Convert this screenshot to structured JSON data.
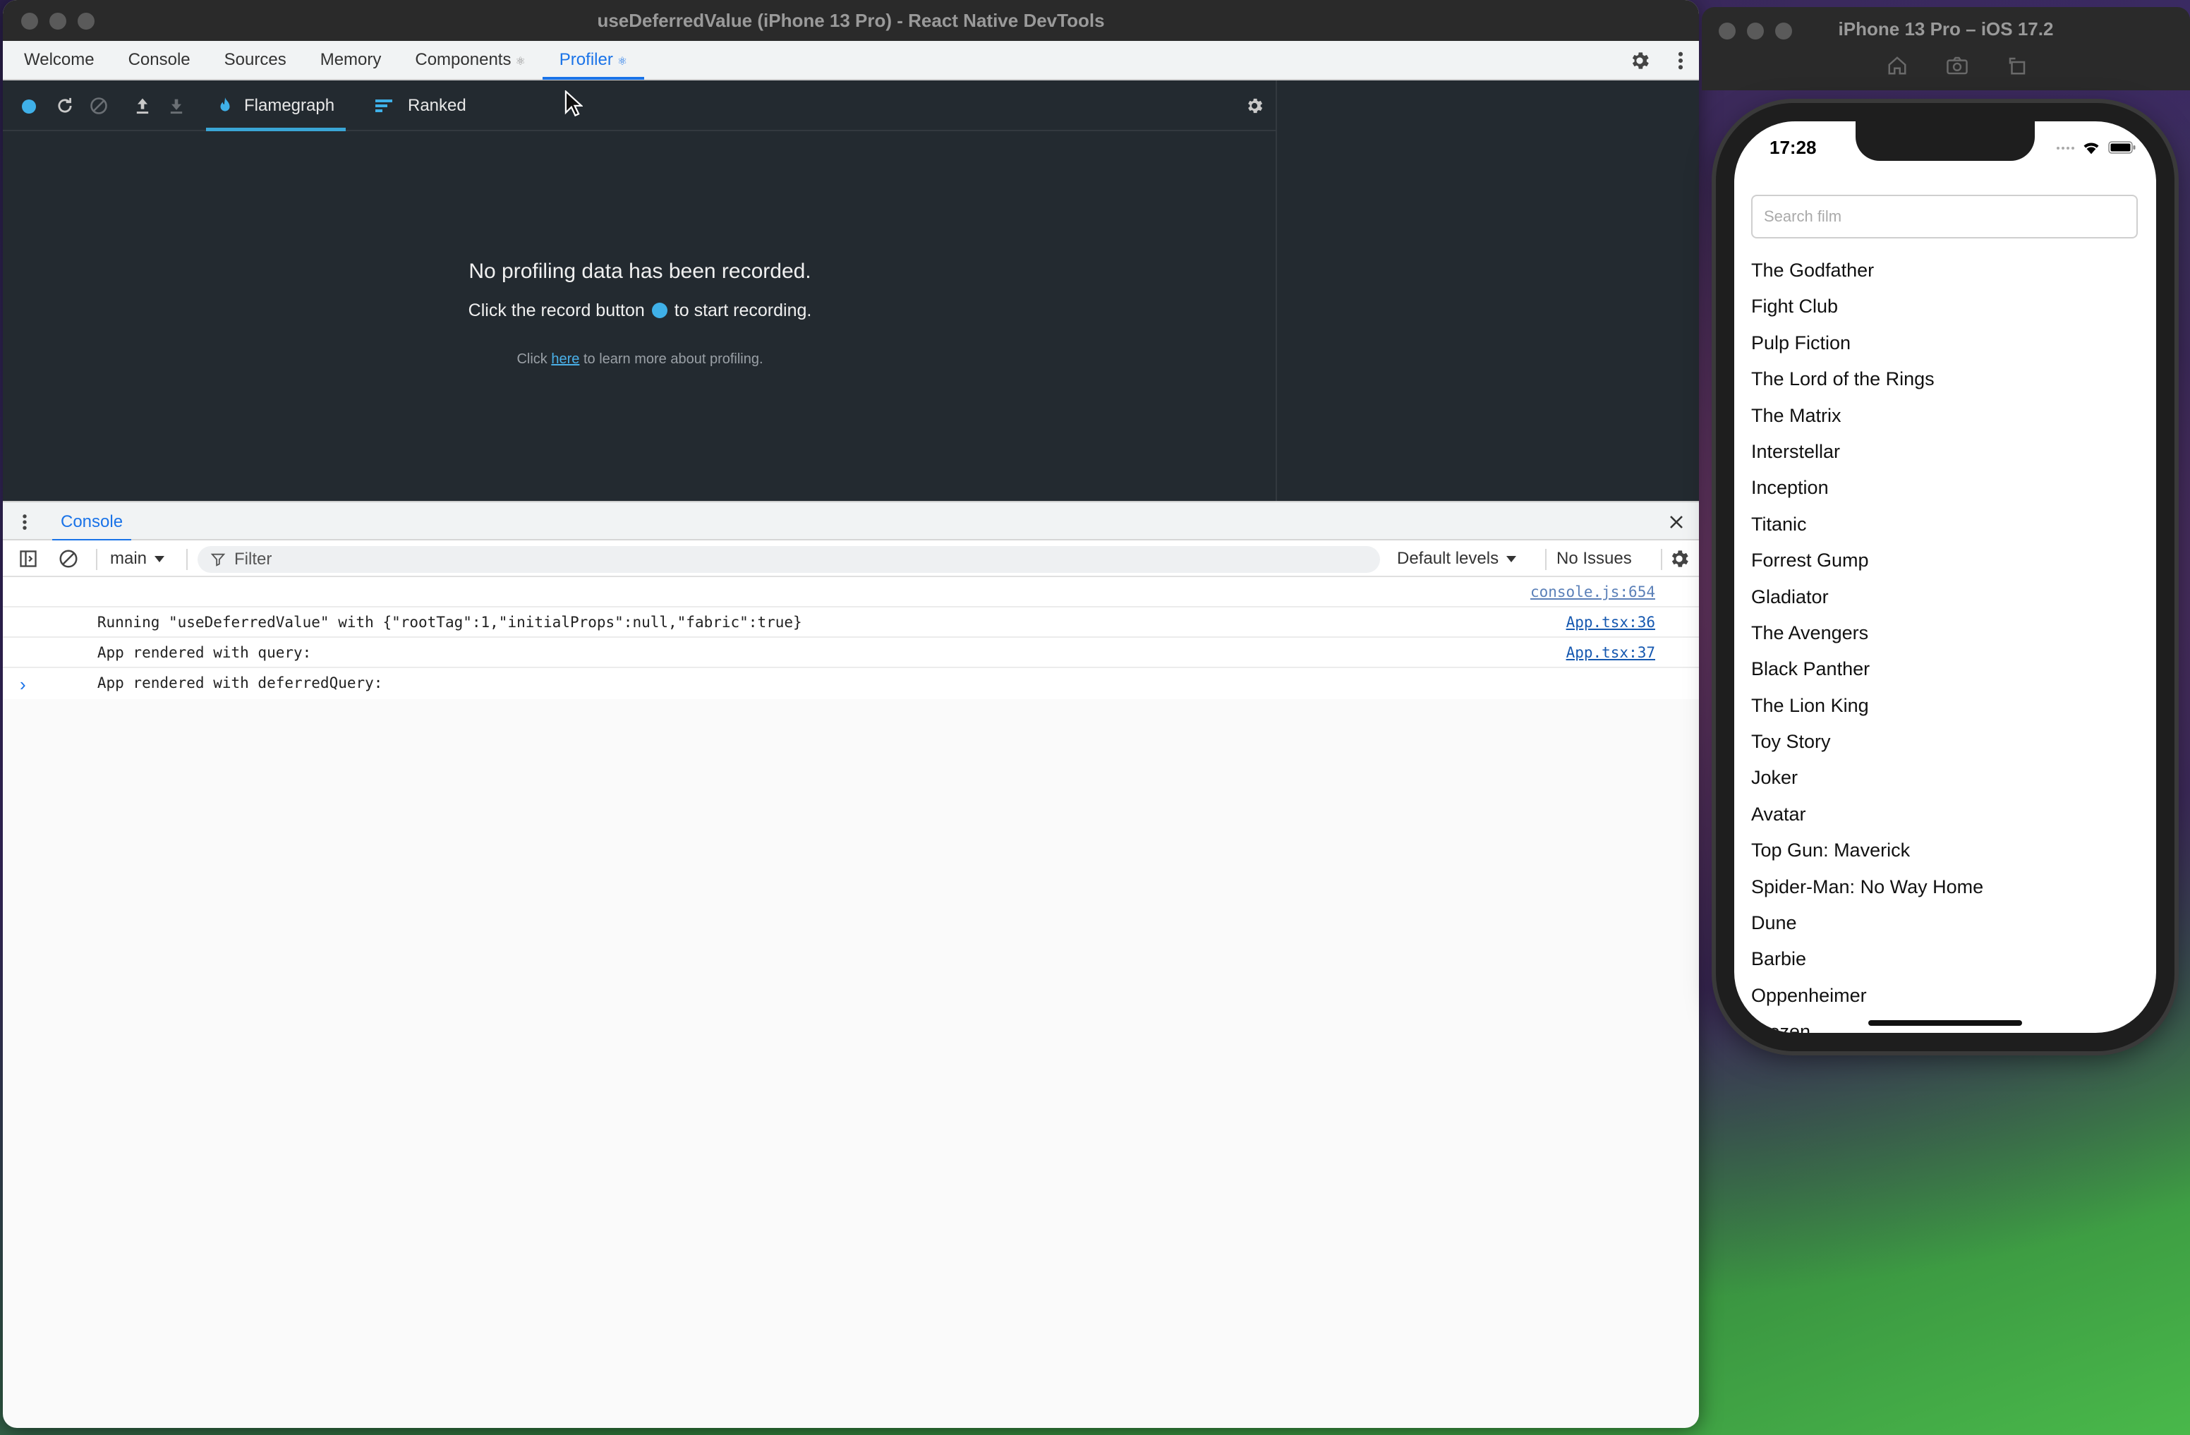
{
  "devtools": {
    "window_title": "useDeferredValue (iPhone 13 Pro) - React Native DevTools",
    "tabs": [
      {
        "label": "Welcome"
      },
      {
        "label": "Console"
      },
      {
        "label": "Sources"
      },
      {
        "label": "Memory"
      },
      {
        "label": "Components",
        "react_mark": "⚛"
      },
      {
        "label": "Profiler",
        "react_mark": "⚛",
        "active": true
      }
    ],
    "profiler": {
      "tabs": {
        "flamegraph": "Flamegraph",
        "ranked": "Ranked"
      },
      "empty_title": "No profiling data has been recorded.",
      "empty_hint_before": "Click the record button",
      "empty_hint_after": "to start recording.",
      "learn_before": "Click",
      "learn_link": "here",
      "learn_after": "to learn more about profiling.",
      "accent_color": "#3fb0e8"
    },
    "drawer": {
      "tab_label": "Console",
      "context": "main",
      "filter_placeholder": "Filter",
      "levels": "Default levels",
      "issues": "No Issues",
      "messages": [
        {
          "text": "Running \"useDeferredValue\" with {\"rootTag\":1,\"initialProps\":null,\"fabric\":true}",
          "source": "console.js:654"
        },
        {
          "text": "App rendered with query:",
          "source": "App.tsx:36"
        },
        {
          "text": "App rendered with deferredQuery:",
          "source": "App.tsx:37"
        }
      ],
      "prompt": "›"
    }
  },
  "simulator": {
    "window_title": "iPhone 13 Pro – iOS 17.2",
    "status_time": "17:28",
    "search_placeholder": "Search film",
    "films": [
      "The Godfather",
      "Fight Club",
      "Pulp Fiction",
      "The Lord of the Rings",
      "The Matrix",
      "Interstellar",
      "Inception",
      "Titanic",
      "Forrest Gump",
      "Gladiator",
      "The Avengers",
      "Black Panther",
      "The Lion King",
      "Toy Story",
      "Joker",
      "Avatar",
      "Top Gun: Maverick",
      "Spider-Man: No Way Home",
      "Dune",
      "Barbie",
      "Oppenheimer",
      "Frozen"
    ]
  }
}
